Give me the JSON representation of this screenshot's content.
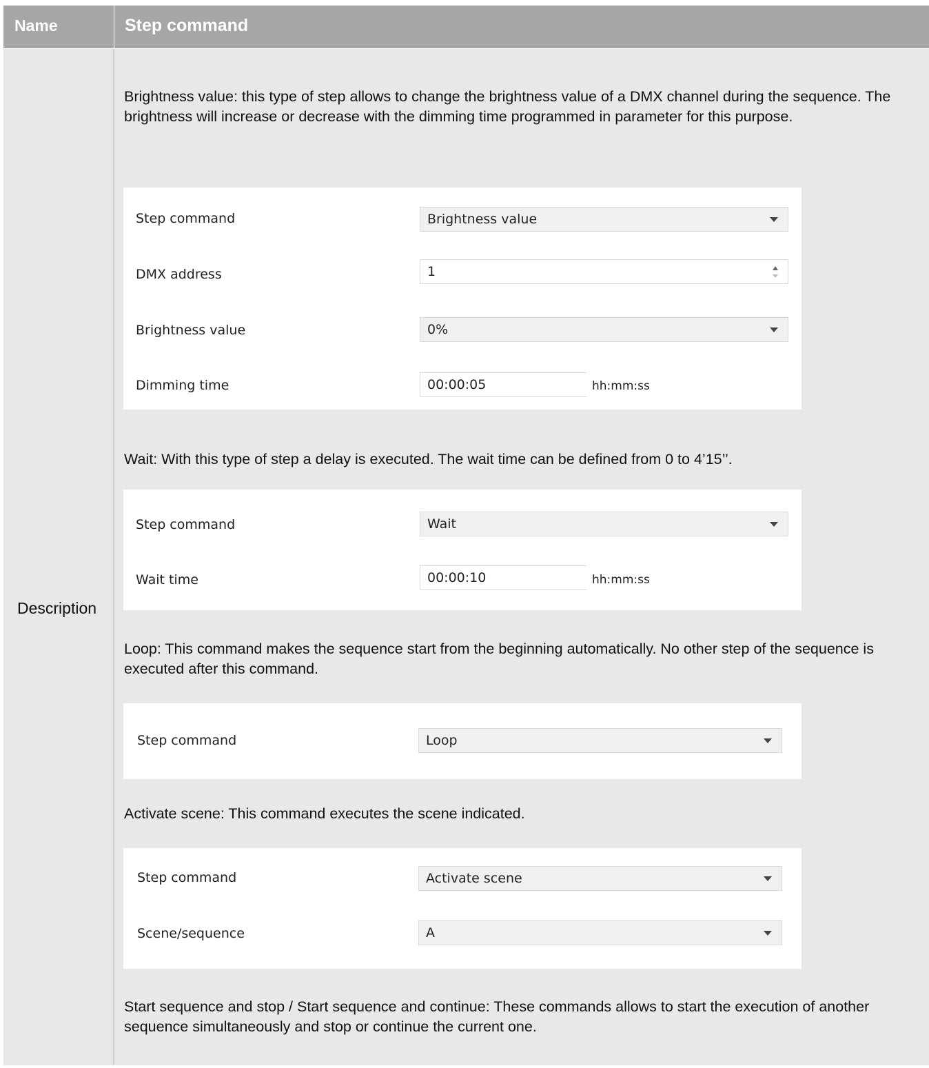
{
  "table": {
    "header_name": "Name",
    "header_title": "Step command",
    "row_label": "Description"
  },
  "paragraphs": {
    "brightness": "Brightness value: this type of step allows to change the brightness value of a DMX channel during the sequence. The brightness will increase or decrease with the dimming time programmed in parameter for this purpose.",
    "wait": "Wait: With this type of step a delay is executed. The wait time can be defined from 0 to 4’15’’.",
    "loop": "Loop: This command makes the sequence start from the beginning automatically. No other step of the sequence is executed after this command.",
    "activate": "Activate scene: This command executes the scene indicated.",
    "start": "Start sequence and stop / Start sequence and continue: These commands allows to start the execution of another sequence simultaneously and stop or continue the current one."
  },
  "panel_brightness": {
    "step_command_label": "Step command",
    "step_command_value": "Brightness value",
    "dmx_address_label": "DMX address",
    "dmx_address_value": "1",
    "brightness_label": "Brightness value",
    "brightness_value": "0%",
    "dimming_time_label": "Dimming time",
    "dimming_time_value": "00:00:05",
    "dimming_time_unit": "hh:mm:ss"
  },
  "panel_wait": {
    "step_command_label": "Step command",
    "step_command_value": "Wait",
    "wait_time_label": "Wait time",
    "wait_time_value": "00:00:10",
    "wait_time_unit": "hh:mm:ss"
  },
  "panel_loop": {
    "step_command_label": "Step command",
    "step_command_value": "Loop"
  },
  "panel_activate": {
    "step_command_label": "Step command",
    "step_command_value": "Activate scene",
    "scene_label": "Scene/sequence",
    "scene_value": "A"
  },
  "icons": {
    "dropdown": "chevron-down-icon",
    "spinner": "spinner-arrows-icon"
  },
  "colors": {
    "header_bg": "#a6a6a6",
    "cell_bg": "#e8e8e8",
    "panel_bg": "#ffffff",
    "select_bg": "#f0f0f0"
  }
}
